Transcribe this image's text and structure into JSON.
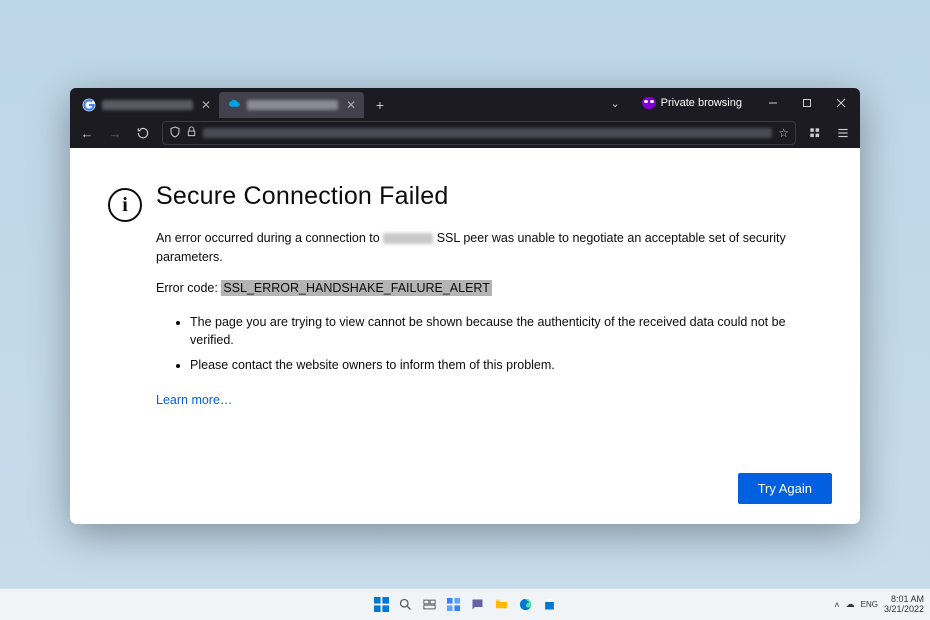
{
  "browser": {
    "private_label": "Private browsing",
    "tabs": [
      {
        "label": "s",
        "active": false
      },
      {
        "label": "",
        "active": true
      }
    ]
  },
  "error": {
    "title": "Secure Connection Failed",
    "desc_before": "An error occurred during a connection to",
    "desc_after": "SSL peer was unable to negotiate an acceptable set of security parameters.",
    "code_label": "Error code:",
    "code_value": "SSL_ERROR_HANDSHAKE_FAILURE_ALERT",
    "bullets": [
      "The page you are trying to view cannot be shown because the authenticity of the received data could not be verified.",
      "Please contact the website owners to inform them of this problem."
    ],
    "learn_more": "Learn more…",
    "try_again": "Try Again"
  },
  "taskbar": {
    "time": "8:01 AM",
    "date": "3/21/2022"
  }
}
